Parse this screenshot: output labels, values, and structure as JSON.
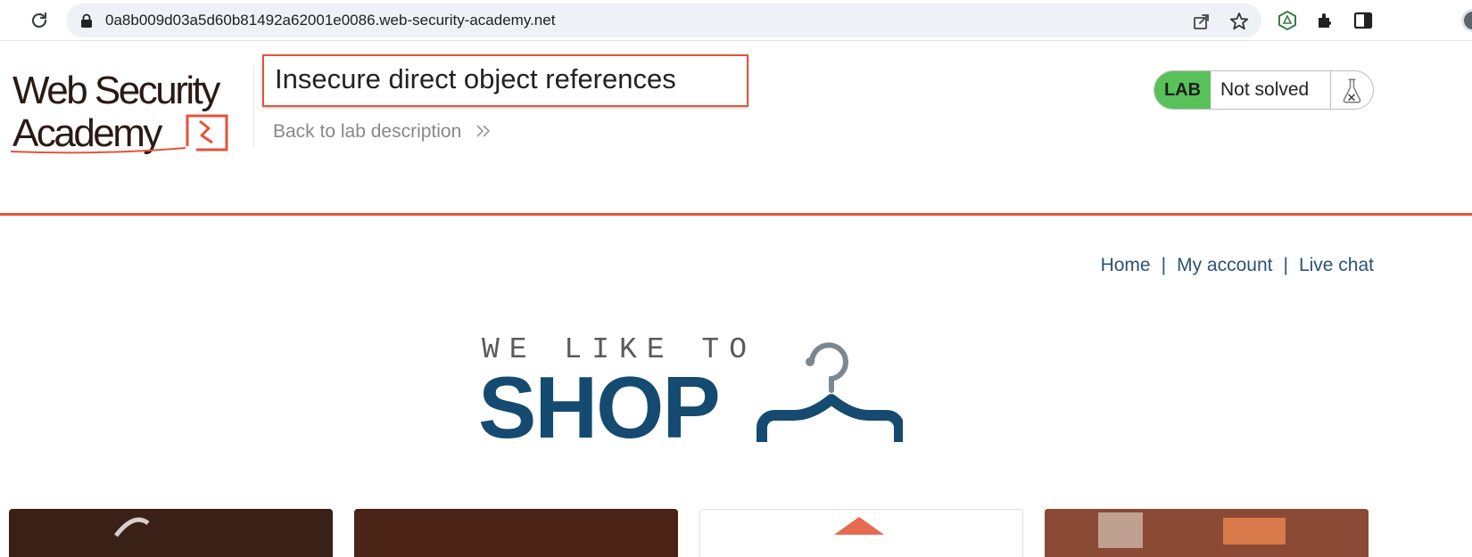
{
  "browser": {
    "url": "0a8b009d03a5d60b81492a62001e0086.web-security-academy.net",
    "icons": [
      "reload-icon",
      "lock-icon",
      "share-icon",
      "star-icon",
      "extension-hex-icon",
      "puzzle-icon",
      "sidepanel-icon",
      "avatar"
    ]
  },
  "academy": {
    "logo_text": "Web Security Academy",
    "lab_title": "Insecure direct object references",
    "back_link": "Back to lab description",
    "lab_badge": "LAB",
    "lab_status": "Not solved"
  },
  "shop": {
    "nav": {
      "home": "Home",
      "separator": "|",
      "my_account": "My account",
      "live_chat": "Live chat"
    },
    "logo_top": "WE LIKE TO",
    "logo_main": "SHOP"
  },
  "colors": {
    "accent_orange": "#e5533b",
    "lab_green": "#58c15a",
    "shop_blue": "#154b70",
    "nav_blue": "#2a5278"
  }
}
